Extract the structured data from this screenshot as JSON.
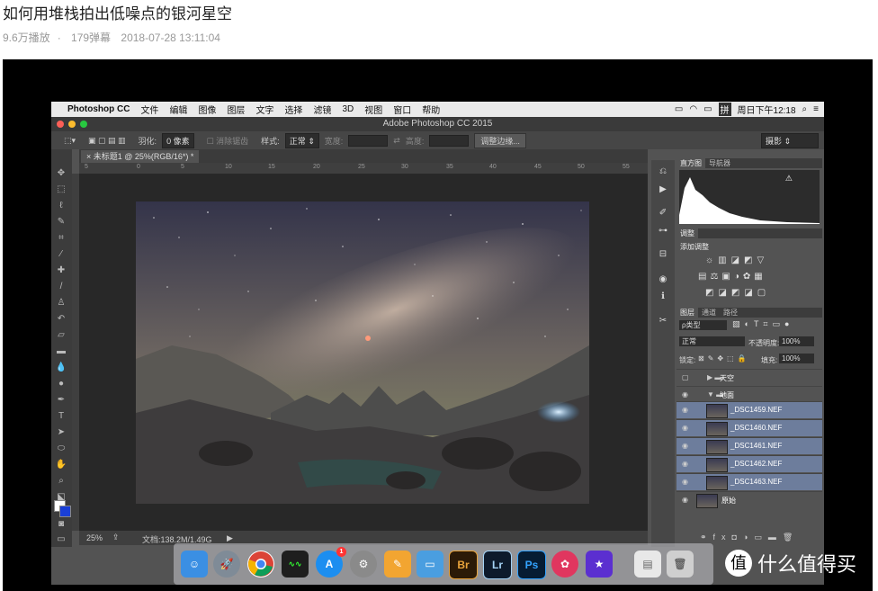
{
  "page": {
    "title": "如何用堆栈拍出低噪点的银河星空",
    "views": "9.6万播放",
    "separator": "·",
    "danmaku": "179弹幕",
    "datetime": "2018-07-28 13:11:04"
  },
  "mac_menubar": {
    "apple": "",
    "app": "Photoshop CC",
    "items": [
      "文件",
      "编辑",
      "图像",
      "图层",
      "文字",
      "选择",
      "滤镜",
      "3D",
      "视图",
      "窗口",
      "帮助"
    ],
    "clock": "周日下午12:18",
    "input_method": "拼"
  },
  "ps": {
    "window_title": "Adobe Photoshop CC 2015",
    "options": {
      "feather_label": "羽化:",
      "feather_value": "0 像素",
      "antialias_label": "消除锯齿",
      "style_label": "样式:",
      "style_value": "正常",
      "width_label": "宽度:",
      "height_label": "高度:",
      "refine_button": "调整边缘...",
      "workspace": "摄影"
    },
    "doc_tab": "未标题1 @ 25%(RGB/16*) *",
    "ruler_ticks": [
      "5",
      "0",
      "5",
      "10",
      "15",
      "20",
      "25",
      "30",
      "35",
      "40",
      "45",
      "50",
      "55"
    ],
    "status": {
      "zoom": "25%",
      "doc_size": "文档:138.2M/1.49G"
    },
    "panels": {
      "histogram_tabs": [
        "直方图",
        "导航器"
      ],
      "adjust_tab": "调整",
      "adjust_add": "添加调整",
      "layers_tabs": [
        "图层",
        "通道",
        "路径"
      ],
      "kind_filter": "ρ类型",
      "blend_mode": "正常",
      "opacity_label": "不透明度:",
      "opacity_value": "100%",
      "lock_label": "锁定:",
      "fill_label": "填充:",
      "fill_value": "100%",
      "layers": [
        {
          "name": "天空",
          "type": "group",
          "selected": false
        },
        {
          "name": "地面",
          "type": "group-open",
          "selected": false
        },
        {
          "name": "_DSC1459.NEF",
          "type": "layer",
          "selected": true
        },
        {
          "name": "_DSC1460.NEF",
          "type": "layer",
          "selected": true
        },
        {
          "name": "_DSC1461.NEF",
          "type": "layer",
          "selected": true
        },
        {
          "name": "_DSC1462.NEF",
          "type": "layer",
          "selected": true
        },
        {
          "name": "_DSC1463.NEF",
          "type": "layer",
          "selected": true
        },
        {
          "name": "原始",
          "type": "layer",
          "selected": false
        }
      ]
    }
  },
  "dock": {
    "apps": [
      "finder-icon",
      "launchpad-icon",
      "chrome-icon",
      "activity-monitor-icon",
      "app-store-icon",
      "system-preferences-icon",
      "pages-icon",
      "keynote-icon",
      "bridge-icon",
      "lightroom-icon",
      "photoshop-icon",
      "pinyin-icon",
      "imovie-icon",
      "preview-icon",
      "trash-icon"
    ],
    "labels": {
      "bridge": "Br",
      "lightroom": "Lr",
      "photoshop": "Ps"
    },
    "appstore_badge": "1"
  },
  "watermark": {
    "logo": "值",
    "text": "什么值得买"
  }
}
